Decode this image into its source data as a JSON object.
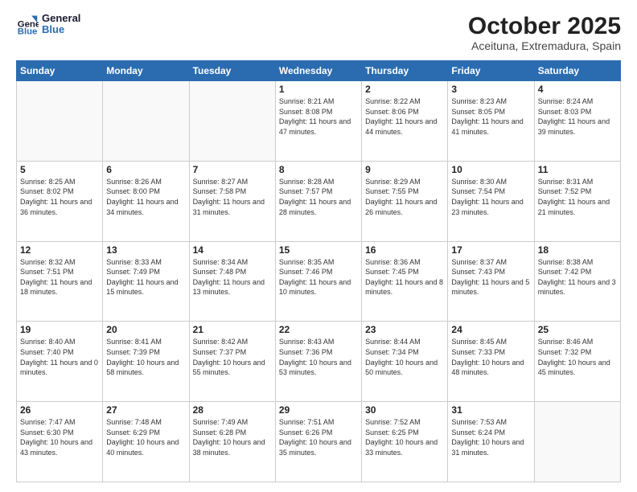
{
  "logo": {
    "line1": "General",
    "line2": "Blue"
  },
  "title": "October 2025",
  "subtitle": "Aceituna, Extremadura, Spain",
  "days_of_week": [
    "Sunday",
    "Monday",
    "Tuesday",
    "Wednesday",
    "Thursday",
    "Friday",
    "Saturday"
  ],
  "weeks": [
    [
      {
        "day": "",
        "info": ""
      },
      {
        "day": "",
        "info": ""
      },
      {
        "day": "",
        "info": ""
      },
      {
        "day": "1",
        "info": "Sunrise: 8:21 AM\nSunset: 8:08 PM\nDaylight: 11 hours and 47 minutes."
      },
      {
        "day": "2",
        "info": "Sunrise: 8:22 AM\nSunset: 8:06 PM\nDaylight: 11 hours and 44 minutes."
      },
      {
        "day": "3",
        "info": "Sunrise: 8:23 AM\nSunset: 8:05 PM\nDaylight: 11 hours and 41 minutes."
      },
      {
        "day": "4",
        "info": "Sunrise: 8:24 AM\nSunset: 8:03 PM\nDaylight: 11 hours and 39 minutes."
      }
    ],
    [
      {
        "day": "5",
        "info": "Sunrise: 8:25 AM\nSunset: 8:02 PM\nDaylight: 11 hours and 36 minutes."
      },
      {
        "day": "6",
        "info": "Sunrise: 8:26 AM\nSunset: 8:00 PM\nDaylight: 11 hours and 34 minutes."
      },
      {
        "day": "7",
        "info": "Sunrise: 8:27 AM\nSunset: 7:58 PM\nDaylight: 11 hours and 31 minutes."
      },
      {
        "day": "8",
        "info": "Sunrise: 8:28 AM\nSunset: 7:57 PM\nDaylight: 11 hours and 28 minutes."
      },
      {
        "day": "9",
        "info": "Sunrise: 8:29 AM\nSunset: 7:55 PM\nDaylight: 11 hours and 26 minutes."
      },
      {
        "day": "10",
        "info": "Sunrise: 8:30 AM\nSunset: 7:54 PM\nDaylight: 11 hours and 23 minutes."
      },
      {
        "day": "11",
        "info": "Sunrise: 8:31 AM\nSunset: 7:52 PM\nDaylight: 11 hours and 21 minutes."
      }
    ],
    [
      {
        "day": "12",
        "info": "Sunrise: 8:32 AM\nSunset: 7:51 PM\nDaylight: 11 hours and 18 minutes."
      },
      {
        "day": "13",
        "info": "Sunrise: 8:33 AM\nSunset: 7:49 PM\nDaylight: 11 hours and 15 minutes."
      },
      {
        "day": "14",
        "info": "Sunrise: 8:34 AM\nSunset: 7:48 PM\nDaylight: 11 hours and 13 minutes."
      },
      {
        "day": "15",
        "info": "Sunrise: 8:35 AM\nSunset: 7:46 PM\nDaylight: 11 hours and 10 minutes."
      },
      {
        "day": "16",
        "info": "Sunrise: 8:36 AM\nSunset: 7:45 PM\nDaylight: 11 hours and 8 minutes."
      },
      {
        "day": "17",
        "info": "Sunrise: 8:37 AM\nSunset: 7:43 PM\nDaylight: 11 hours and 5 minutes."
      },
      {
        "day": "18",
        "info": "Sunrise: 8:38 AM\nSunset: 7:42 PM\nDaylight: 11 hours and 3 minutes."
      }
    ],
    [
      {
        "day": "19",
        "info": "Sunrise: 8:40 AM\nSunset: 7:40 PM\nDaylight: 11 hours and 0 minutes."
      },
      {
        "day": "20",
        "info": "Sunrise: 8:41 AM\nSunset: 7:39 PM\nDaylight: 10 hours and 58 minutes."
      },
      {
        "day": "21",
        "info": "Sunrise: 8:42 AM\nSunset: 7:37 PM\nDaylight: 10 hours and 55 minutes."
      },
      {
        "day": "22",
        "info": "Sunrise: 8:43 AM\nSunset: 7:36 PM\nDaylight: 10 hours and 53 minutes."
      },
      {
        "day": "23",
        "info": "Sunrise: 8:44 AM\nSunset: 7:34 PM\nDaylight: 10 hours and 50 minutes."
      },
      {
        "day": "24",
        "info": "Sunrise: 8:45 AM\nSunset: 7:33 PM\nDaylight: 10 hours and 48 minutes."
      },
      {
        "day": "25",
        "info": "Sunrise: 8:46 AM\nSunset: 7:32 PM\nDaylight: 10 hours and 45 minutes."
      }
    ],
    [
      {
        "day": "26",
        "info": "Sunrise: 7:47 AM\nSunset: 6:30 PM\nDaylight: 10 hours and 43 minutes."
      },
      {
        "day": "27",
        "info": "Sunrise: 7:48 AM\nSunset: 6:29 PM\nDaylight: 10 hours and 40 minutes."
      },
      {
        "day": "28",
        "info": "Sunrise: 7:49 AM\nSunset: 6:28 PM\nDaylight: 10 hours and 38 minutes."
      },
      {
        "day": "29",
        "info": "Sunrise: 7:51 AM\nSunset: 6:26 PM\nDaylight: 10 hours and 35 minutes."
      },
      {
        "day": "30",
        "info": "Sunrise: 7:52 AM\nSunset: 6:25 PM\nDaylight: 10 hours and 33 minutes."
      },
      {
        "day": "31",
        "info": "Sunrise: 7:53 AM\nSunset: 6:24 PM\nDaylight: 10 hours and 31 minutes."
      },
      {
        "day": "",
        "info": ""
      }
    ]
  ]
}
